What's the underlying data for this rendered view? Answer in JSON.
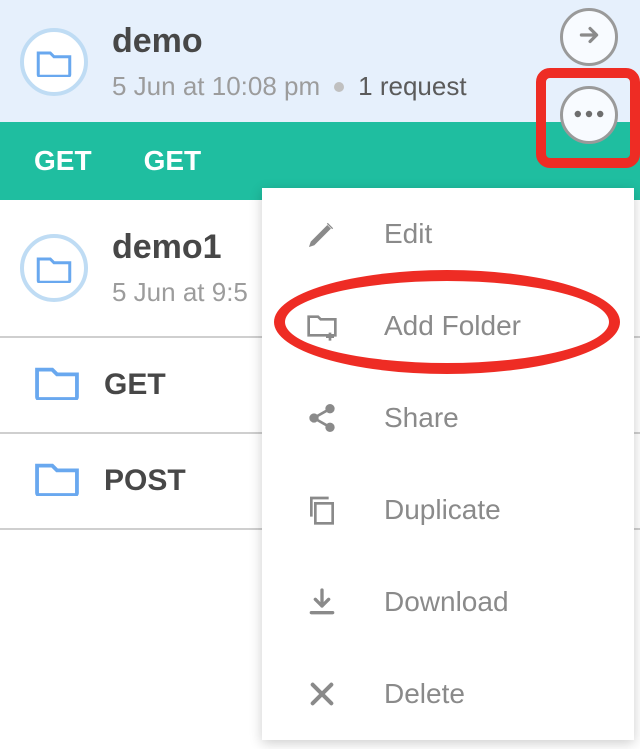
{
  "selected": {
    "title": "demo",
    "date": "5 Jun at 10:08 pm",
    "requests_label": "1 request"
  },
  "tabs": {
    "t1": "GET",
    "t2": "GET"
  },
  "row2": {
    "title": "demo1",
    "date": "5 Jun at 9:5"
  },
  "requests": {
    "r1": "GET",
    "r2": "POST"
  },
  "menu": {
    "edit": "Edit",
    "add_folder": "Add Folder",
    "share": "Share",
    "duplicate": "Duplicate",
    "download": "Download",
    "delete": "Delete"
  },
  "icons": {
    "folder": "folder-icon",
    "arrow_right": "arrow-right-icon",
    "dots": "more-dots-icon",
    "pencil": "pencil-icon",
    "folder_plus": "folder-plus-icon",
    "share": "share-icon",
    "duplicate": "duplicate-icon",
    "download": "download-icon",
    "close": "close-icon"
  },
  "colors": {
    "accent_green": "#1fbea0",
    "folder_blue": "#69a8ef",
    "highlight_red": "#ee2c24"
  }
}
